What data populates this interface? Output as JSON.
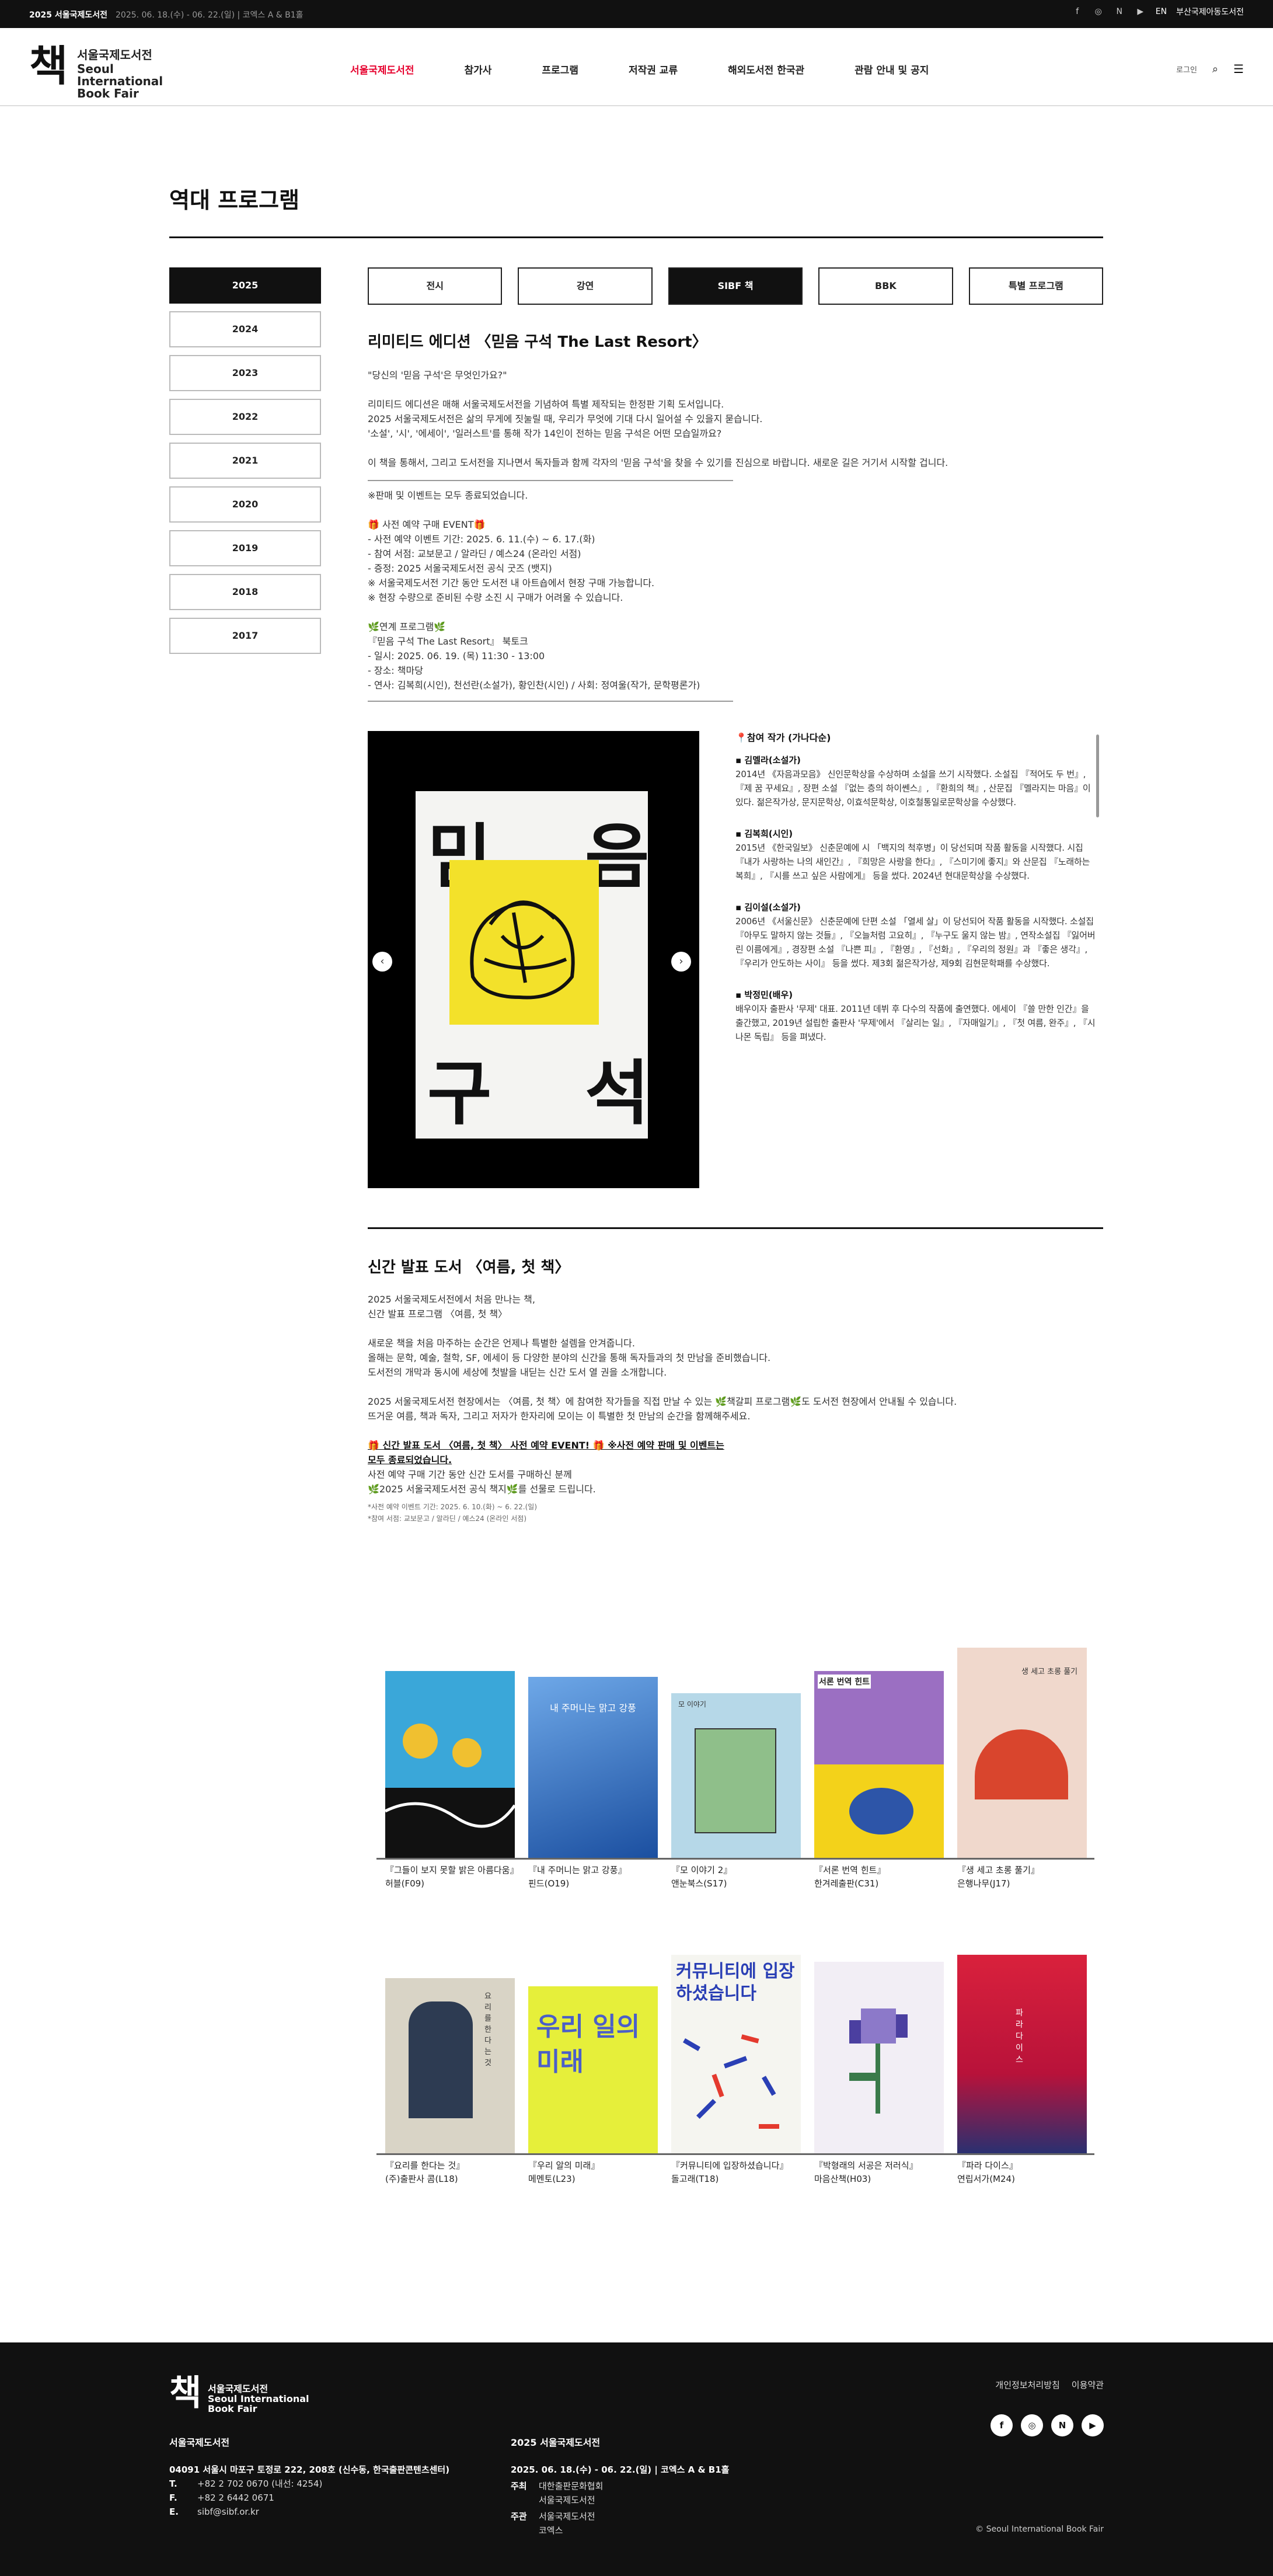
{
  "topbar": {
    "event": "2025 서울국제도서전",
    "dates": "2025. 06. 18.(수) - 06. 22.(일) | 코엑스 A & B1홀",
    "lang": "EN",
    "busan": "부산국제아동도서전",
    "sns": [
      "facebook-icon",
      "instagram-icon",
      "naver-icon",
      "youtube-icon"
    ]
  },
  "header": {
    "logo_kr": "서울국제도서전",
    "logo_en1": "Seoul International",
    "logo_en2": "Book Fair",
    "logo_mark": "책",
    "login": "로그인",
    "nav": [
      "서울국제도서전",
      "참가사",
      "프로그램",
      "저작권 교류",
      "해외도서전 한국관",
      "관람 안내 및 공지"
    ]
  },
  "page": {
    "title": "역대 프로그램"
  },
  "years": [
    "2025",
    "2024",
    "2023",
    "2022",
    "2021",
    "2020",
    "2019",
    "2018",
    "2017"
  ],
  "tabs": [
    "전시",
    "강연",
    "SIBF 책",
    "BBK",
    "특별 프로그램"
  ],
  "section1": {
    "title": "리미티드 에디션 〈믿음 구석 The Last Resort〉",
    "p1": "\"당신의 '믿음 구석'은 무엇인가요?\"",
    "p2": [
      "리미티드 에디션은 매해 서울국제도서전을 기념하여 특별 제작되는 한정판 기획 도서입니다.",
      "2025 서울국제도서전은 삶의 무게에 짓눌릴 때, 우리가 무엇에 기대 다시 일어설 수 있을지 묻습니다.",
      "'소설', '시', '에세이', '일러스트'를 통해 작가 14인이 전하는 믿음 구석은 어떤 모습일까요?"
    ],
    "p3": "이 책을 통해서, 그리고 도서전을 지나면서 독자들과 함께 각자의 '믿음 구석'을 찾을 수 있기를 진심으로 바랍니다. 새로운 길은 거기서 시작할 겁니다.",
    "sold": "※판매 및 이벤트는 모두 종료되었습니다.",
    "event": [
      "🎁 사전 예약 구매 EVENT🎁",
      "- 사전 예약 이벤트 기간: 2025. 6. 11.(수) ~ 6. 17.(화)",
      "- 참여 서점: 교보문고 / 알라딘 / 예스24 (온라인 서점)",
      "- 증정: 2025 서울국제도서전 공식 굿즈 (뱃지)",
      "※ 서울국제도서전 기간 동안 도서전 내 아트숍에서 현장 구매 가능합니다.",
      "※ 현장 수량으로 준비된 수량 소진 시 구매가 어려울 수 있습니다."
    ],
    "program": [
      "🌿연계 프로그램🌿",
      "『믿음 구석 The Last Resort』 북토크",
      "- 일시: 2025. 06. 19. (목) 11:30 - 13:00",
      "- 장소: 책마당",
      "- 연사: 김복희(시인), 천선란(소설가), 황인찬(시인) / 사회: 정여울(작가, 문학평론가)"
    ],
    "cover": {
      "c1": "믿",
      "c2": "음",
      "c3": "구",
      "c4": "석"
    },
    "authors": {
      "heading": "📍참여 작가 (가나다순)",
      "list": [
        {
          "name": "▪ 김멜라(소설가)",
          "bio": "2014년 《자음과모음》 신인문학상을 수상하며 소설을 쓰기 시작했다. 소설집 『적어도 두 번』, 『제 꿈 꾸세요』, 장편 소설 『없는 층의 하이쎈스』, 『환희의 책』, 산문집 『멜라지는 마음』이 있다. 젊은작가상, 문지문학상, 이효석문학상, 이호철통일로문학상을 수상했다."
        },
        {
          "name": "▪ 김복희(시인)",
          "bio": "2015년 《한국일보》 신춘문예에 시 「백지의 척후병」이 당선되며 작품 활동을 시작했다. 시집 『내가 사랑하는 나의 새인간』, 『희망은 사랑을 한다』, 『스미기에 좋지』와 산문집 『노래하는 복희』, 『시를 쓰고 싶은 사람에게』 등을 썼다. 2024년 현대문학상을 수상했다."
        },
        {
          "name": "▪ 김이설(소설가)",
          "bio": "2006년 《서울신문》 신춘문예에 단편 소설 「열세 살」이 당선되어 작품 활동을 시작했다. 소설집 『아무도 말하지 않는 것들』, 『오늘처럼 고요히』, 『누구도 울지 않는 밤』, 연작소설집 『잃어버린 이름에게』, 경장편 소설 『나쁜 피』, 『환영』, 『선화』, 『우리의 정원』과 『좋은 생각』, 『우리가 안도하는 사이』 등을 썼다. 제3회 젊은작가상, 제9회 김현문학패를 수상했다."
        },
        {
          "name": "▪ 박정민(배우)",
          "bio": "배우이자 출판사 '무제' 대표. 2011년 데뷔 후 다수의 작품에 출연했다. 에세이 『쓸 만한 인간』을 출간했고, 2019년 설립한 출판사 '무제'에서 『살리는 일』, 『자매일기』, 『첫 여름, 완주』, 『시나몬 독립』 등을 펴냈다."
        }
      ]
    }
  },
  "section2": {
    "title": "신간 발표 도서 〈여름, 첫 책〉",
    "p1": [
      "2025 서울국제도서전에서 처음 만나는 책,",
      "신간 발표 프로그램 〈여름, 첫 책〉"
    ],
    "p2": [
      "새로운 책을 처음 마주하는 순간은 언제나 특별한 설렘을 안겨줍니다.",
      "올해는 문학, 예술, 철학, SF, 에세이 등 다양한 분야의 신간을 통해 독자들과의 첫 만남을 준비했습니다.",
      "도서전의 개막과 동시에 세상에 첫발을 내딛는 신간 도서 열 권을 소개합니다."
    ],
    "p3": [
      "2025 서울국제도서전 현장에서는 〈여름, 첫 책〉에 참여한 작가들을 직접 만날 수 있는 🌿책갈피 프로그램🌿도 도서전 현장에서 안내될 수 있습니다.",
      "뜨거운 여름, 책과 독자, 그리고 저자가 한자리에 모이는 이 특별한 첫 만남의 순간을 함께해주세요."
    ],
    "ev1": "🎁 신간 발표 도서 〈여름, 첫 책〉 사전 예약 EVENT! 🎁 ※사전 예약 판매 및 이벤트는",
    "ev2": "모두 종료되었습니다.",
    "ev3": "사전 예약 구매 기간 동안 신간 도서를 구매하신 분께",
    "ev4": "🌿2025 서울국제도서전 공식 책지🌿를 선물로 드립니다.",
    "note1": "*사전 예약 이벤트 기간: 2025. 6. 10.(화) ~ 6. 22.(일)",
    "note2": "*참여 서점: 교보문고 / 알라딘 / 예스24 (온라인 서점)"
  },
  "books_row1": [
    {
      "title": "『그들이 보지 못할 밝은 아름다움』",
      "pub": "허블(F09)",
      "color": "#3aa7d9",
      "text": ""
    },
    {
      "title": "『내 주머니는 맑고 강풍』",
      "pub": "핀드(O19)",
      "color": "#2a64b8",
      "text": "내 주머니는 맑고 강풍"
    },
    {
      "title": "『모 이야기 2』",
      "pub": "앤눈북스(S17)",
      "color": "#b6d8e8",
      "text": "모 이야기"
    },
    {
      "title": "『서론 번역 힌트』",
      "pub": "한겨레출판(C31)",
      "color": "#e8762e",
      "text": "서론 번역 힌트"
    },
    {
      "title": "『생 세고 초롱 풀기』",
      "pub": "은행나무(J17)",
      "color": "#f0d8cc",
      "text": "생 세고 초롱 풀기"
    }
  ],
  "books_row2": [
    {
      "title": "『요리를 한다는 것』",
      "pub": "(주)출판사 콤(L18)",
      "color": "#d9d4c6",
      "text": "요리를 한다는 것"
    },
    {
      "title": "『우리 알의 미래』",
      "pub": "메멘토(L23)",
      "color": "#e6ef3a",
      "text": "우리 일의 미래"
    },
    {
      "title": "『커뮤니티에 입장하셨습니다』",
      "pub": "돌고래(T18)",
      "color": "#f5f5f0",
      "text": "커뮤니티에 입장하셨습니다"
    },
    {
      "title": "『박형래의 서공은 저러식』",
      "pub": "마음산책(H03)",
      "color": "#f2eef5",
      "text": ""
    },
    {
      "title": "『파라 다이스』",
      "pub": "연립서가(M24)",
      "color": "#d9213c",
      "text": "파라 다이스"
    }
  ],
  "footer": {
    "org": "서울국제도서전",
    "addr": "04091 서울시 마포구 토정로 222, 208호 (신수동, 한국출판콘텐츠센터)",
    "tel_l": "T.",
    "tel": "+82 2 702 0670 (내선: 4254)",
    "fax_l": "F.",
    "fax": "+82 2 6442 0671",
    "email_l": "E.",
    "email": "sibf@sibf.or.kr",
    "event": "2025 서울국제도서전",
    "event_dates": "2025. 06. 18.(수) - 06. 22.(일) | 코엑스 A & B1홀",
    "host_l": "주최",
    "host1": "대한출판문화협회",
    "host2": "서울국제도서전",
    "org_l": "주관",
    "org1": "서울국제도서전",
    "org2": "코엑스",
    "privacy": "개인정보처리방침",
    "terms": "이용약관",
    "copy": "© Seoul International Book Fair"
  }
}
